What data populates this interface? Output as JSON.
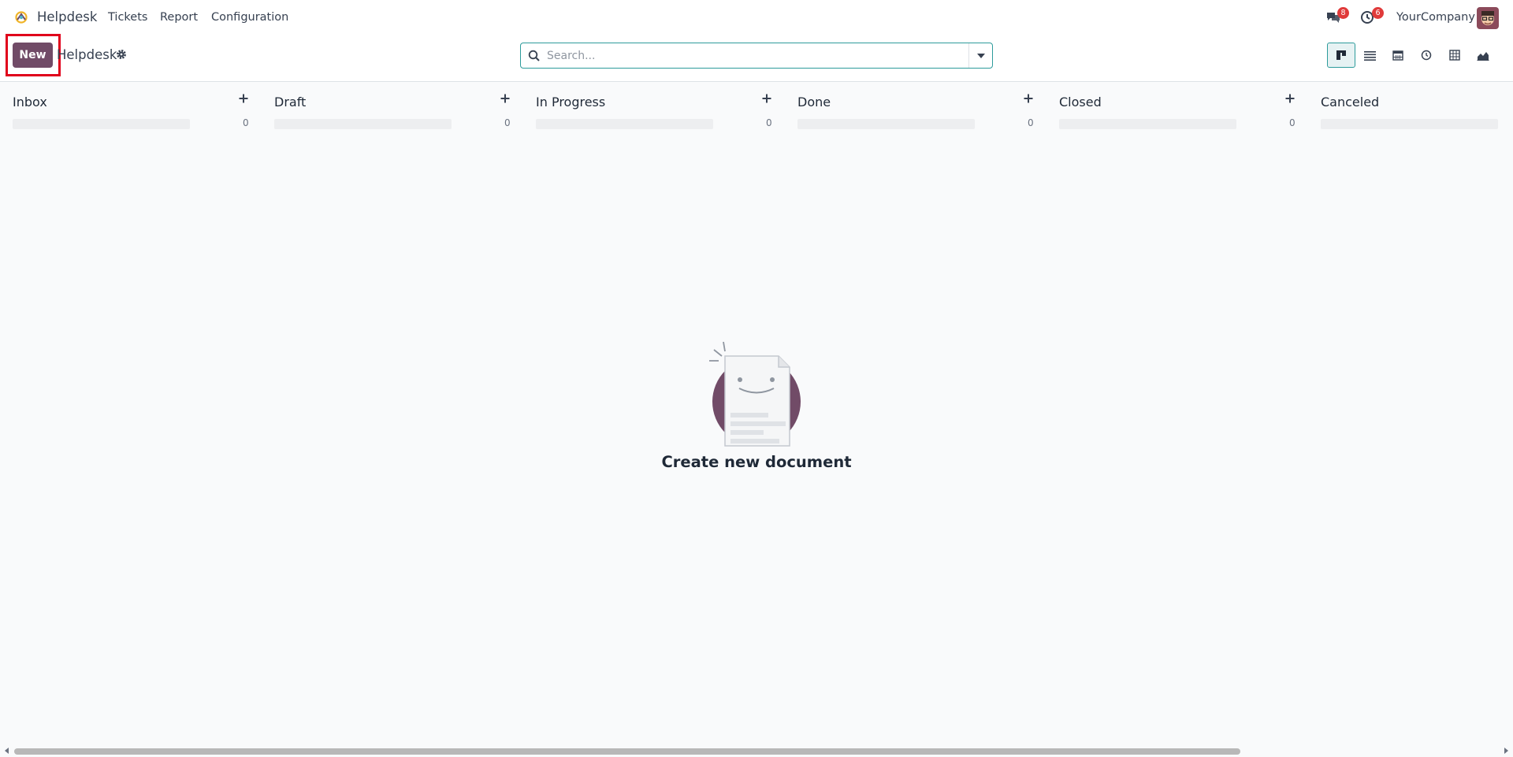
{
  "app": {
    "name": "Helpdesk"
  },
  "menu": [
    {
      "label": "Tickets"
    },
    {
      "label": "Report"
    },
    {
      "label": "Configuration"
    }
  ],
  "systray": {
    "messages_count": "8",
    "activities_count": "6",
    "company": "YourCompany"
  },
  "control": {
    "new_label": "New",
    "breadcrumb": "Helpdesk",
    "search_placeholder": "Search..."
  },
  "views": [
    "kanban-view",
    "list-view",
    "calendar-view",
    "activity-view",
    "pivot-view",
    "graph-view"
  ],
  "columns": [
    {
      "title": "Inbox",
      "count": "0"
    },
    {
      "title": "Draft",
      "count": "0"
    },
    {
      "title": "In Progress",
      "count": "0"
    },
    {
      "title": "Done",
      "count": "0"
    },
    {
      "title": "Closed",
      "count": "0"
    },
    {
      "title": "Canceled",
      "count": ""
    }
  ],
  "empty_state": {
    "title": "Create new document"
  },
  "colors": {
    "primary": "#714b67",
    "accent": "#2d9b9b",
    "badge": "#e03a3a",
    "highlight": "#e0001b"
  }
}
